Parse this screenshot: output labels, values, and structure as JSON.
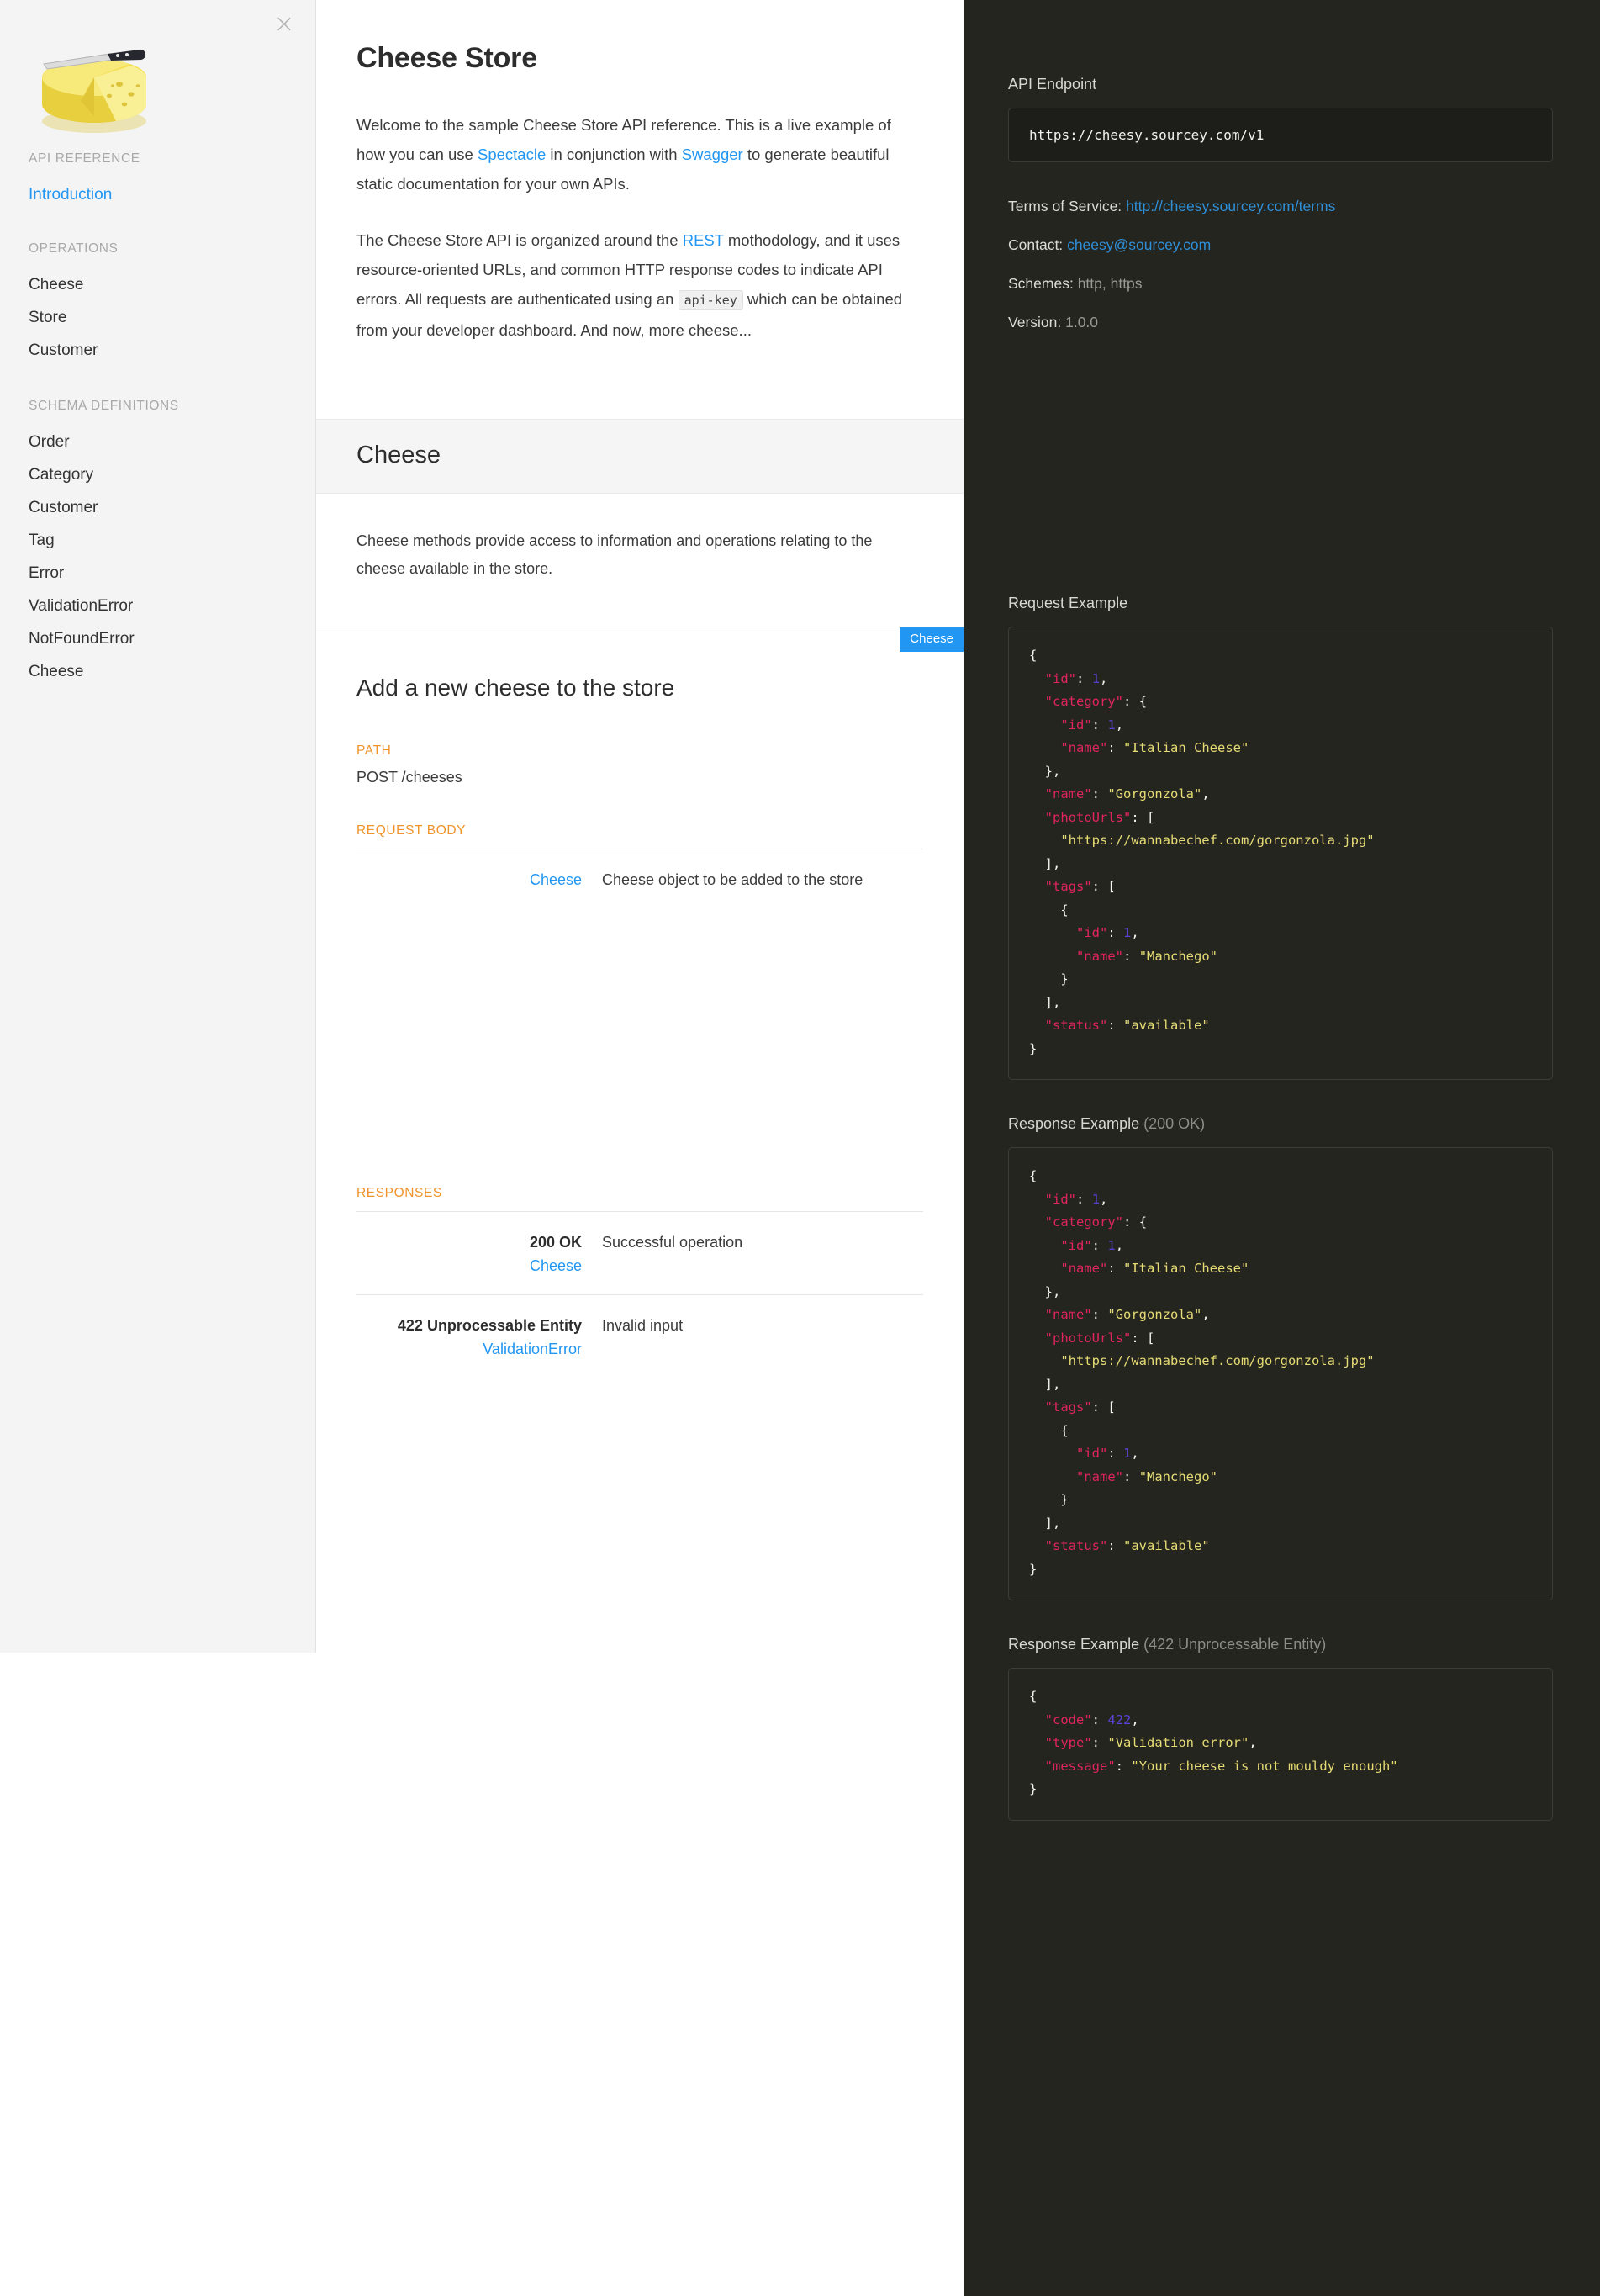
{
  "sidebar": {
    "close_label": "×",
    "logo_alt": "cheese-wheel-with-knife",
    "sections": [
      {
        "heading": "API REFERENCE",
        "items": [
          {
            "label": "Introduction",
            "active": true
          }
        ]
      },
      {
        "heading": "OPERATIONS",
        "items": [
          {
            "label": "Cheese",
            "active": false
          },
          {
            "label": "Store",
            "active": false
          },
          {
            "label": "Customer",
            "active": false
          }
        ]
      },
      {
        "heading": "SCHEMA DEFINITIONS",
        "items": [
          {
            "label": "Order",
            "active": false
          },
          {
            "label": "Category",
            "active": false
          },
          {
            "label": "Customer",
            "active": false
          },
          {
            "label": "Tag",
            "active": false
          },
          {
            "label": "Error",
            "active": false
          },
          {
            "label": "ValidationError",
            "active": false
          },
          {
            "label": "NotFoundError",
            "active": false
          },
          {
            "label": "Cheese",
            "active": false
          }
        ]
      }
    ]
  },
  "content": {
    "title": "Cheese Store",
    "paragraph1": {
      "part1": "Welcome to the sample Cheese Store API reference. This is a live example of how you can use ",
      "link1": "Spectacle",
      "part2": " in conjunction with ",
      "link2": "Swagger",
      "part3": " to generate beautiful static documentation for your own APIs."
    },
    "paragraph2": {
      "part1": "The Cheese Store API is organized around the ",
      "link1": "REST",
      "part2": " mothodology, and it uses resource-oriented URLs, and common HTTP response codes to indicate API errors. All requests are authenticated using an ",
      "code": "api-key",
      "part3": " which can be obtained from your developer dashboard. And now, more cheese..."
    },
    "tag": {
      "name": "Cheese",
      "description": "Cheese methods provide access to information and operations relating to the cheese available in the store."
    },
    "operation": {
      "badge": "Cheese",
      "title": "Add a new cheese to the store",
      "path_label": "PATH",
      "path_value": "POST /cheeses",
      "request_body_label": "REQUEST BODY",
      "request_body": {
        "type": "Cheese",
        "description": "Cheese object to be added to the store"
      },
      "responses_label": "RESPONSES",
      "responses": [
        {
          "code": "200 OK",
          "schema": "Cheese",
          "description": "Successful operation"
        },
        {
          "code": "422 Unprocessable Entity",
          "schema": "ValidationError",
          "description": "Invalid input"
        }
      ]
    }
  },
  "panel": {
    "api_endpoint_label": "API Endpoint",
    "api_endpoint_value": "https://cheesy.sourcey.com/v1",
    "terms_label": "Terms of Service:",
    "terms_value": "http://cheesy.sourcey.com/terms",
    "contact_label": "Contact:",
    "contact_value": "cheesy@sourcey.com",
    "schemes_label": "Schemes:",
    "schemes_value": "http, https",
    "version_label": "Version:",
    "version_value": "1.0.0",
    "request_example_label": "Request Example",
    "response_200_label": "Response Example",
    "response_200_status": "(200 OK)",
    "response_422_label": "Response Example",
    "response_422_status": "(422 Unprocessable Entity)"
  },
  "code_samples": {
    "request": {
      "id": 1,
      "category": {
        "id": 1,
        "name": "Italian Cheese"
      },
      "name": "Gorgonzola",
      "photoUrls": [
        "https://wannabechef.com/gorgonzola.jpg"
      ],
      "tags": [
        {
          "id": 1,
          "name": "Manchego"
        }
      ],
      "status": "available"
    },
    "response_200": {
      "id": 1,
      "category": {
        "id": 1,
        "name": "Italian Cheese"
      },
      "name": "Gorgonzola",
      "photoUrls": [
        "https://wannabechef.com/gorgonzola.jpg"
      ],
      "tags": [
        {
          "id": 1,
          "name": "Manchego"
        }
      ],
      "status": "available"
    },
    "response_422": {
      "code": 422,
      "type": "Validation error",
      "message": "Your cheese is not mouldy enough"
    }
  },
  "colors": {
    "accent_blue": "#2196f3",
    "section_orange": "#f0932b",
    "dark_panel": "#24251f",
    "sidebar_bg": "#f4f4f4",
    "json_key": "#e0245e",
    "json_string": "#e6db74",
    "json_number": "#5b42d6"
  }
}
